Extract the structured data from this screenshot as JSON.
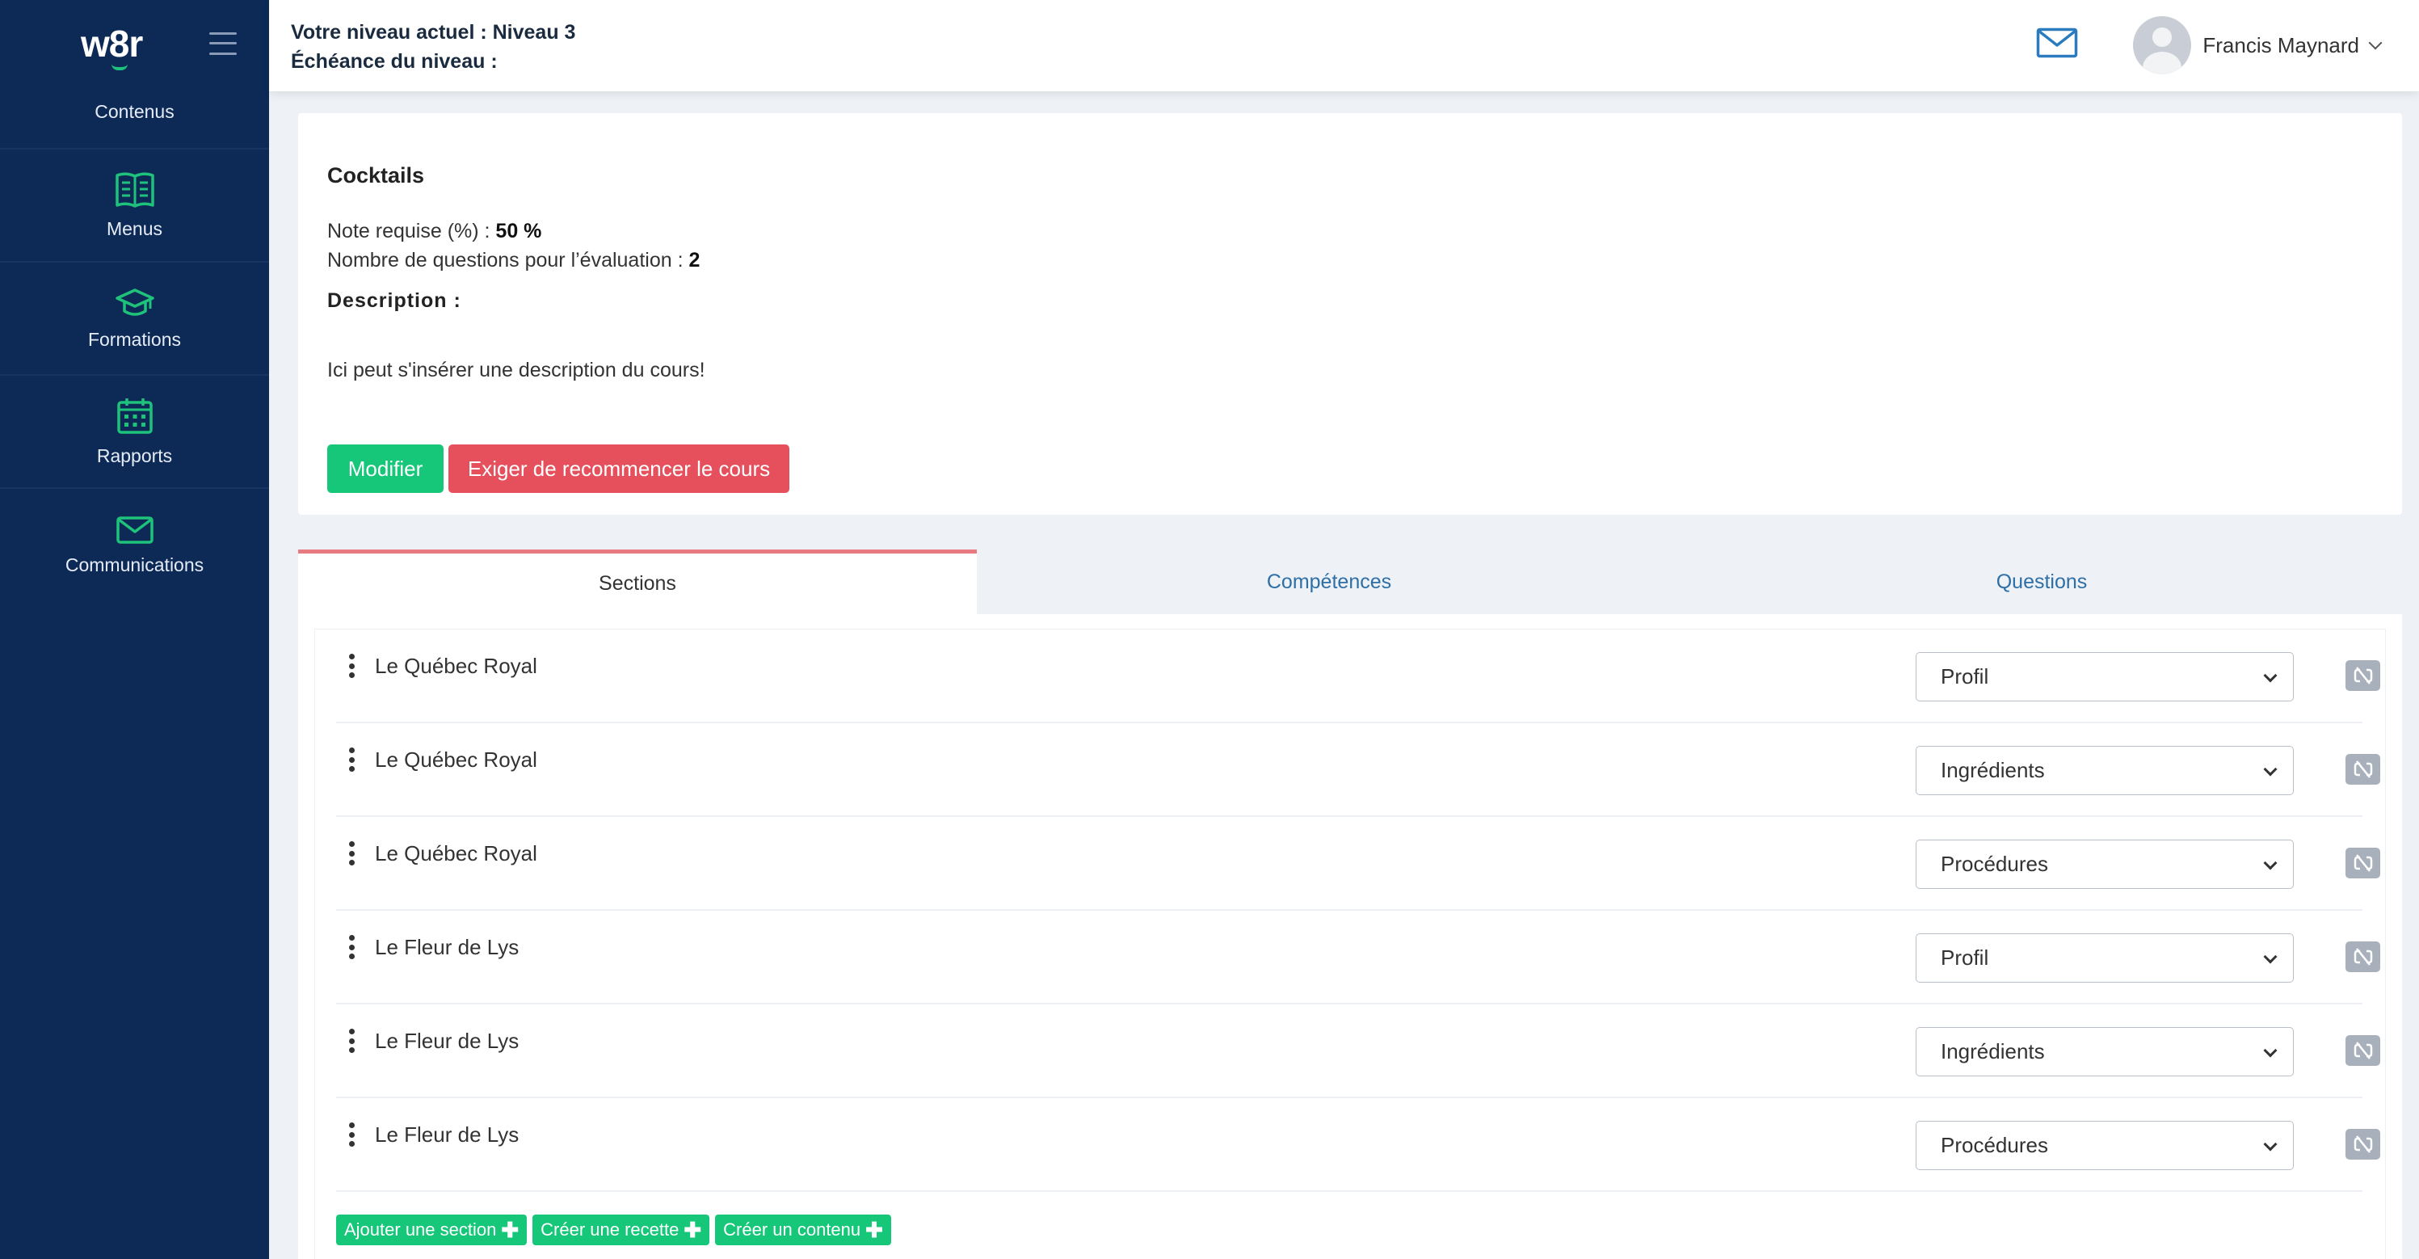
{
  "app": {
    "logo": "w8r"
  },
  "sidebar": {
    "items": [
      {
        "label": "Contenus",
        "icon": "contents-icon"
      },
      {
        "label": "Menus",
        "icon": "book-icon"
      },
      {
        "label": "Formations",
        "icon": "graduation-cap-icon"
      },
      {
        "label": "Rapports",
        "icon": "calendar-icon"
      },
      {
        "label": "Communications",
        "icon": "envelope-icon"
      }
    ]
  },
  "header": {
    "level_line": "Votre niveau actuel : Niveau 3",
    "deadline_line": "Échéance du niveau :",
    "user_name": "Francis Maynard"
  },
  "course": {
    "title": "Cocktails",
    "required_label": "Note requise (%) : ",
    "required_value": "50 %",
    "questions_label": "Nombre de questions pour l’évaluation : ",
    "questions_value": "2",
    "description_label": "Description :",
    "description": "Ici peut s'insérer une description du cours!",
    "edit_label": "Modifier",
    "restart_label": "Exiger de recommencer le cours"
  },
  "tabs": [
    {
      "label": "Sections",
      "active": true
    },
    {
      "label": "Compétences",
      "active": false
    },
    {
      "label": "Questions",
      "active": false
    }
  ],
  "sections": [
    {
      "name": "Le Québec Royal",
      "type": "Profil"
    },
    {
      "name": "Le Québec Royal",
      "type": "Ingrédients"
    },
    {
      "name": "Le Québec Royal",
      "type": "Procédures"
    },
    {
      "name": "Le Fleur de Lys",
      "type": "Profil"
    },
    {
      "name": "Le Fleur de Lys",
      "type": "Ingrédients"
    },
    {
      "name": "Le Fleur de Lys",
      "type": "Procédures"
    }
  ],
  "actions": {
    "add_section": "Ajouter une section",
    "create_recipe": "Créer une recette",
    "create_content": "Créer un contenu"
  },
  "colors": {
    "sidebar_bg": "#0d2a57",
    "accent_green": "#16c77a",
    "danger_red": "#e5505c",
    "tab_accent": "#e87a82"
  }
}
